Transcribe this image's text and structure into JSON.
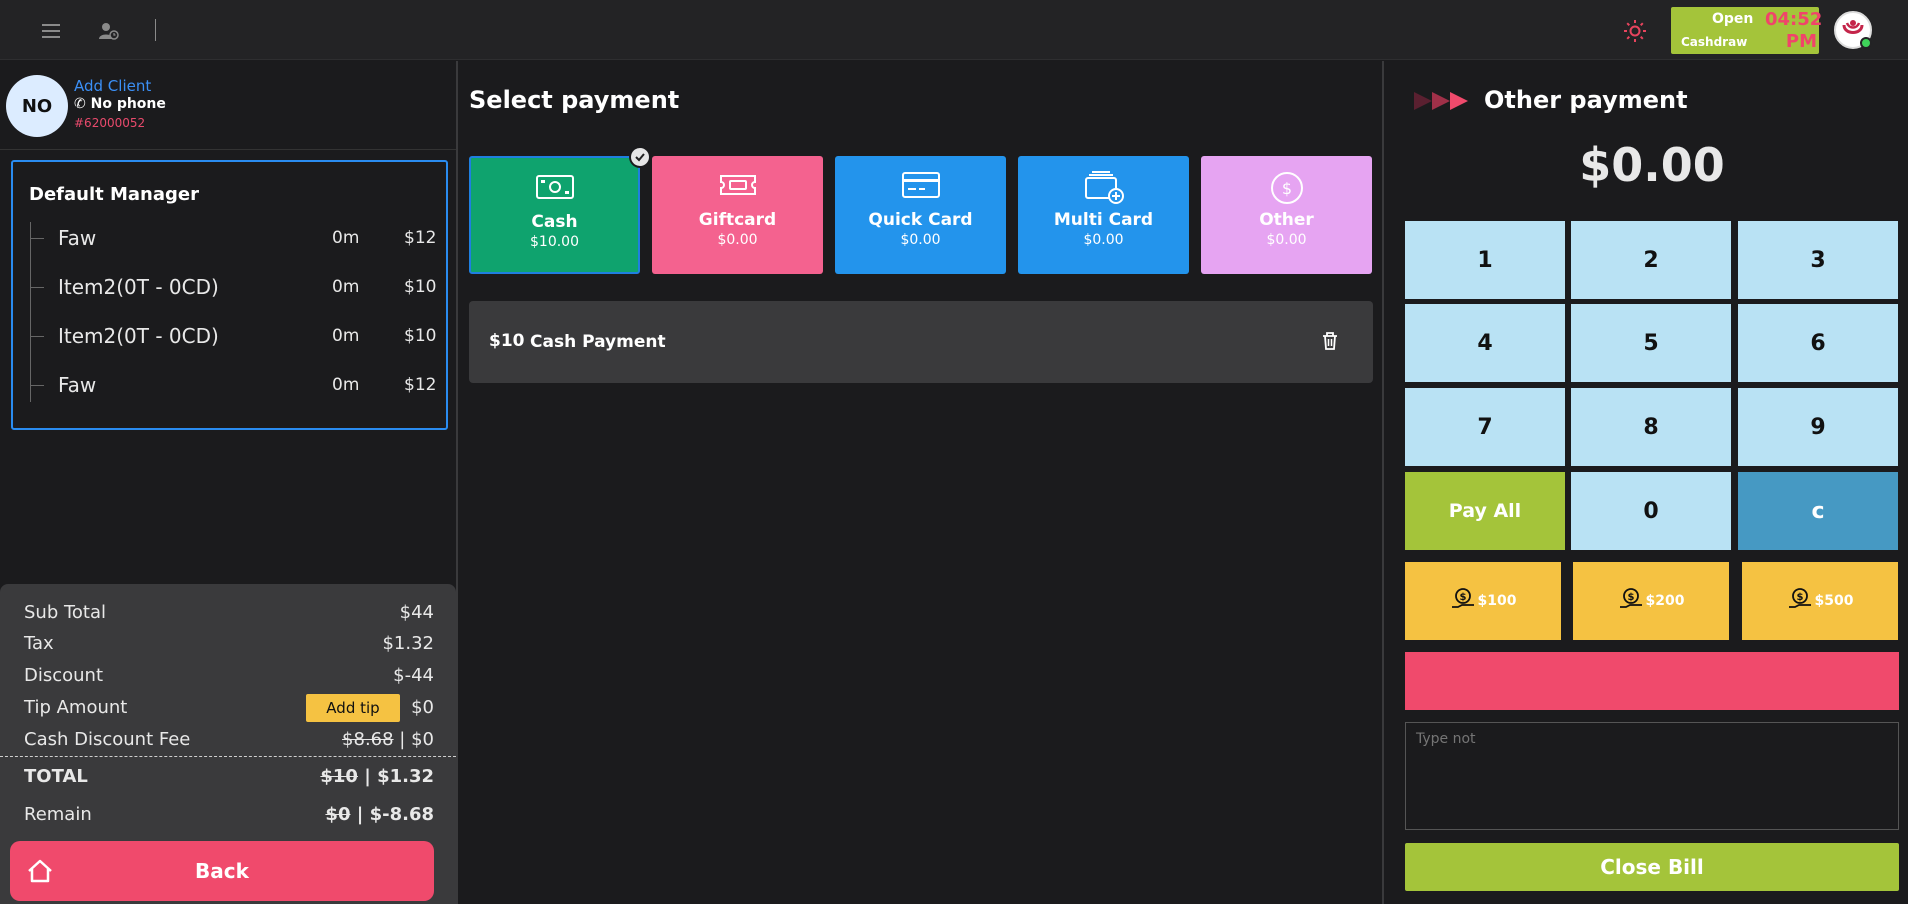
{
  "topbar": {
    "cashdraw_open": "Open",
    "cashdraw_label": "Cashdraw",
    "time": "04:52",
    "ampm": "PM",
    "colors": {
      "cashdraw": "#a4c43a",
      "time": "#f0446a"
    }
  },
  "client": {
    "initials": "NO",
    "add_label": "Add Client",
    "phone": "No phone",
    "id": "#62000052"
  },
  "manager": {
    "title": "Default Manager",
    "items": [
      {
        "name": "Faw",
        "time": "0m",
        "price": "$12"
      },
      {
        "name": "Item2(0T - 0CD)",
        "time": "0m",
        "price": "$10"
      },
      {
        "name": "Item2(0T - 0CD)",
        "time": "0m",
        "price": "$10"
      },
      {
        "name": "Faw",
        "time": "0m",
        "price": "$12"
      }
    ]
  },
  "summary": {
    "subtotal_label": "Sub Total",
    "subtotal": "$44",
    "tax_label": "Tax",
    "tax": "$1.32",
    "discount_label": "Discount",
    "discount": "$-44",
    "tip_label": "Tip Amount",
    "add_tip": "Add tip",
    "tip": "$0",
    "cdf_label": "Cash Discount Fee",
    "cdf_old": "$8.68",
    "cdf_sep": " | ",
    "cdf": "$0",
    "total_label": "TOTAL",
    "total_old": "$10",
    "total_sep": " | ",
    "total": "$1.32",
    "remain_label": "Remain",
    "remain_old": "$0",
    "remain_sep": " | ",
    "remain": "$-8.68"
  },
  "back_label": "Back",
  "middle": {
    "title": "Select payment",
    "tiles": [
      {
        "name": "Cash",
        "amount": "$10.00",
        "color": "#0fa36e",
        "icon": "cash-icon"
      },
      {
        "name": "Giftcard",
        "amount": "$0.00",
        "color": "#f4628f",
        "icon": "giftcard-icon"
      },
      {
        "name": "Quick Card",
        "amount": "$0.00",
        "color": "#2394ec",
        "icon": "credit-card-icon"
      },
      {
        "name": "Multi Card",
        "amount": "$0.00",
        "color": "#2394ec",
        "icon": "multi-card-icon"
      },
      {
        "name": "Other",
        "amount": "$0.00",
        "color": "#e6a4f2",
        "icon": "dollar-circle-icon"
      }
    ],
    "payment_row": {
      "amount": "$10",
      "label": "Cash Payment"
    }
  },
  "right": {
    "title": "Other payment",
    "amount": "$0.00",
    "keys": [
      "1",
      "2",
      "3",
      "4",
      "5",
      "6",
      "7",
      "8",
      "9",
      "Pay All",
      "0",
      "c"
    ],
    "quick": [
      "$100",
      "$200",
      "$500"
    ],
    "note_placeholder": "Type not",
    "close_label": "Close Bill"
  }
}
